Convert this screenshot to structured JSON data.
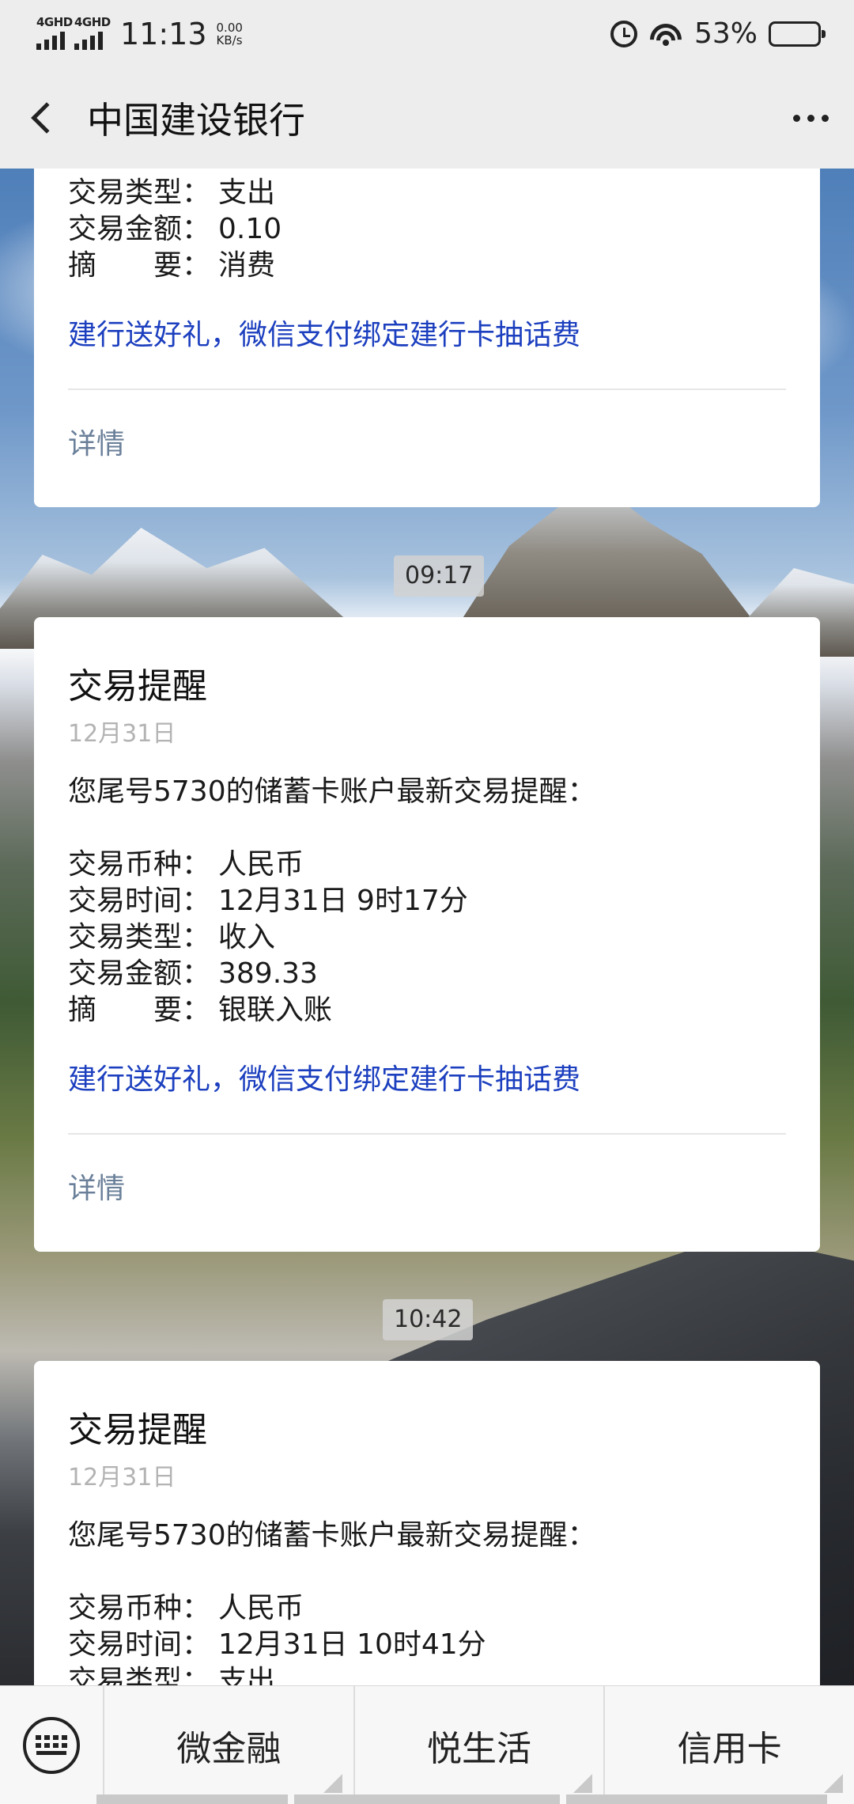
{
  "status_bar": {
    "network_1": "4GHD",
    "network_2": "4GHD",
    "time": "11:13",
    "net_speed_value": "0.00",
    "net_speed_unit": "KB/s",
    "battery_percent": "53%",
    "battery_level": 0.53,
    "icons": [
      "signal-icon",
      "alarm-icon",
      "wifi-icon",
      "battery-icon"
    ]
  },
  "nav": {
    "back_icon": "back-arrow-icon",
    "title": "中国建设银行",
    "more_icon": "more-icon"
  },
  "messages": [
    {
      "fields": [
        {
          "label": "交易类型：",
          "value": "支出"
        },
        {
          "label": "交易金额：",
          "value": "0.10"
        },
        {
          "label": "摘　　要：",
          "value": "消费"
        }
      ],
      "promo": "建行送好礼，微信支付绑定建行卡抽话费",
      "details": "详情"
    },
    {
      "timestamp": "09:17",
      "title": "交易提醒",
      "date": "12月31日",
      "intro": "您尾号5730的储蓄卡账户最新交易提醒：",
      "fields": [
        {
          "label": "交易币种：",
          "value": "人民币"
        },
        {
          "label": "交易时间：",
          "value": "12月31日 9时17分"
        },
        {
          "label": "交易类型：",
          "value": "收入"
        },
        {
          "label": "交易金额：",
          "value": "389.33"
        },
        {
          "label": "摘　　要：",
          "value": "银联入账"
        }
      ],
      "promo": "建行送好礼，微信支付绑定建行卡抽话费",
      "details": "详情"
    },
    {
      "timestamp": "10:42",
      "title": "交易提醒",
      "date": "12月31日",
      "intro": "您尾号5730的储蓄卡账户最新交易提醒：",
      "fields": [
        {
          "label": "交易币种：",
          "value": "人民币"
        },
        {
          "label": "交易时间：",
          "value": "12月31日 10时41分"
        },
        {
          "label": "交易类型：",
          "value": "支出"
        }
      ]
    }
  ],
  "bottom_menu": {
    "keyboard_icon": "keyboard-icon",
    "tabs": [
      "微金融",
      "悦生活",
      "信用卡"
    ]
  }
}
